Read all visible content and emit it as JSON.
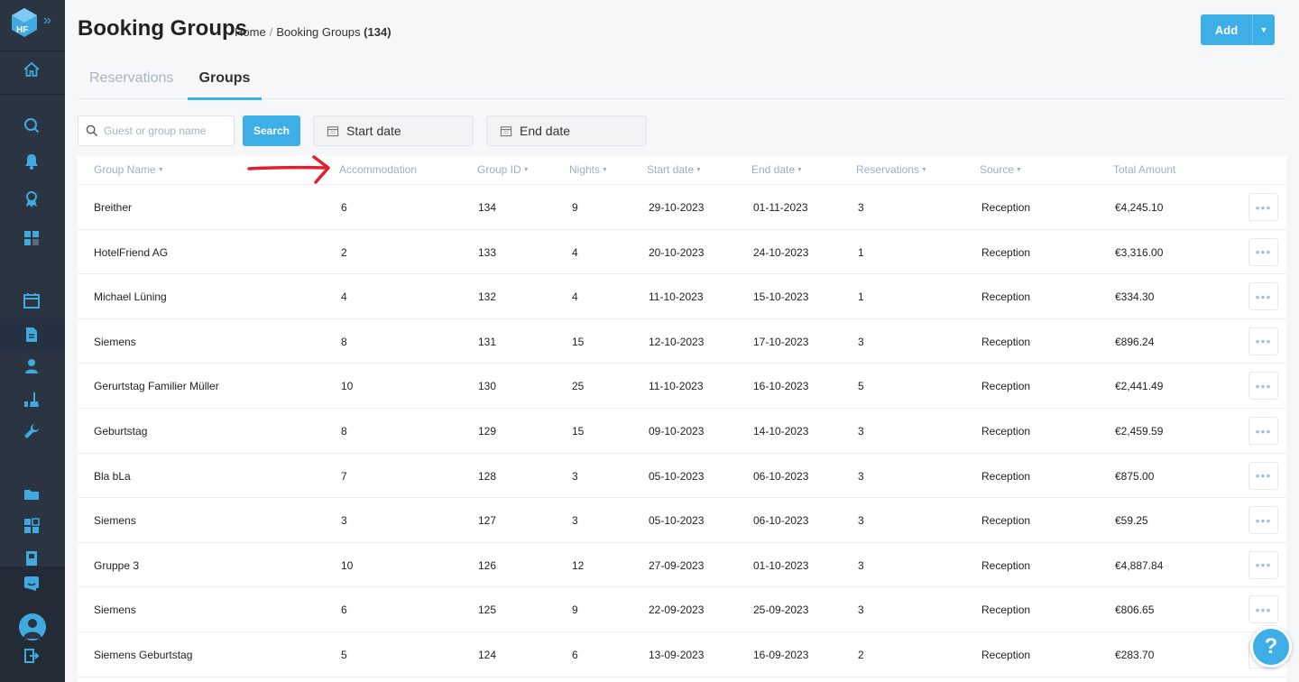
{
  "header": {
    "title": "Booking Groups",
    "breadcrumb_home": "Home",
    "breadcrumb_current": "Booking Groups",
    "breadcrumb_count": "(134)",
    "add_label": "Add"
  },
  "tabs": [
    {
      "label": "Reservations",
      "active": false
    },
    {
      "label": "Groups",
      "active": true
    }
  ],
  "filters": {
    "search_placeholder": "Guest or group name",
    "search_label": "Search",
    "start_date_placeholder": "Start date",
    "end_date_placeholder": "End date"
  },
  "table": {
    "columns": [
      "Group Name",
      "Accommodation",
      "Group ID",
      "Nights",
      "Start date",
      "End date",
      "Reservations",
      "Source",
      "Total Amount"
    ],
    "rows": [
      {
        "name": "Breither",
        "accommodation": "6",
        "group_id": "134",
        "nights": "9",
        "start": "29-10-2023",
        "end": "01-11-2023",
        "reservations": "3",
        "source": "Reception",
        "total": "€4,245.10"
      },
      {
        "name": "HotelFriend AG",
        "accommodation": "2",
        "group_id": "133",
        "nights": "4",
        "start": "20-10-2023",
        "end": "24-10-2023",
        "reservations": "1",
        "source": "Reception",
        "total": "€3,316.00"
      },
      {
        "name": "Michael Lüning",
        "accommodation": "4",
        "group_id": "132",
        "nights": "4",
        "start": "11-10-2023",
        "end": "15-10-2023",
        "reservations": "1",
        "source": "Reception",
        "total": "€334.30"
      },
      {
        "name": "Siemens",
        "accommodation": "8",
        "group_id": "131",
        "nights": "15",
        "start": "12-10-2023",
        "end": "17-10-2023",
        "reservations": "3",
        "source": "Reception",
        "total": "€896.24"
      },
      {
        "name": "Gerurtstag Familier Müller",
        "accommodation": "10",
        "group_id": "130",
        "nights": "25",
        "start": "11-10-2023",
        "end": "16-10-2023",
        "reservations": "5",
        "source": "Reception",
        "total": "€2,441.49"
      },
      {
        "name": "Geburtstag",
        "accommodation": "8",
        "group_id": "129",
        "nights": "15",
        "start": "09-10-2023",
        "end": "14-10-2023",
        "reservations": "3",
        "source": "Reception",
        "total": "€2,459.59"
      },
      {
        "name": "Bla bLa",
        "accommodation": "7",
        "group_id": "128",
        "nights": "3",
        "start": "05-10-2023",
        "end": "06-10-2023",
        "reservations": "3",
        "source": "Reception",
        "total": "€875.00"
      },
      {
        "name": "Siemens",
        "accommodation": "3",
        "group_id": "127",
        "nights": "3",
        "start": "05-10-2023",
        "end": "06-10-2023",
        "reservations": "3",
        "source": "Reception",
        "total": "€59.25"
      },
      {
        "name": "Gruppe 3",
        "accommodation": "10",
        "group_id": "126",
        "nights": "12",
        "start": "27-09-2023",
        "end": "01-10-2023",
        "reservations": "3",
        "source": "Reception",
        "total": "€4,887.84"
      },
      {
        "name": "Siemens",
        "accommodation": "6",
        "group_id": "125",
        "nights": "9",
        "start": "22-09-2023",
        "end": "25-09-2023",
        "reservations": "3",
        "source": "Reception",
        "total": "€806.65"
      },
      {
        "name": "Siemens Geburtstag",
        "accommodation": "5",
        "group_id": "124",
        "nights": "6",
        "start": "13-09-2023",
        "end": "16-09-2023",
        "reservations": "2",
        "source": "Reception",
        "total": "€283.70"
      }
    ]
  },
  "help_label": "?",
  "colors": {
    "accent": "#3daee6",
    "sidebar": "#2b3542",
    "annotation_arrow": "#e0202e"
  }
}
